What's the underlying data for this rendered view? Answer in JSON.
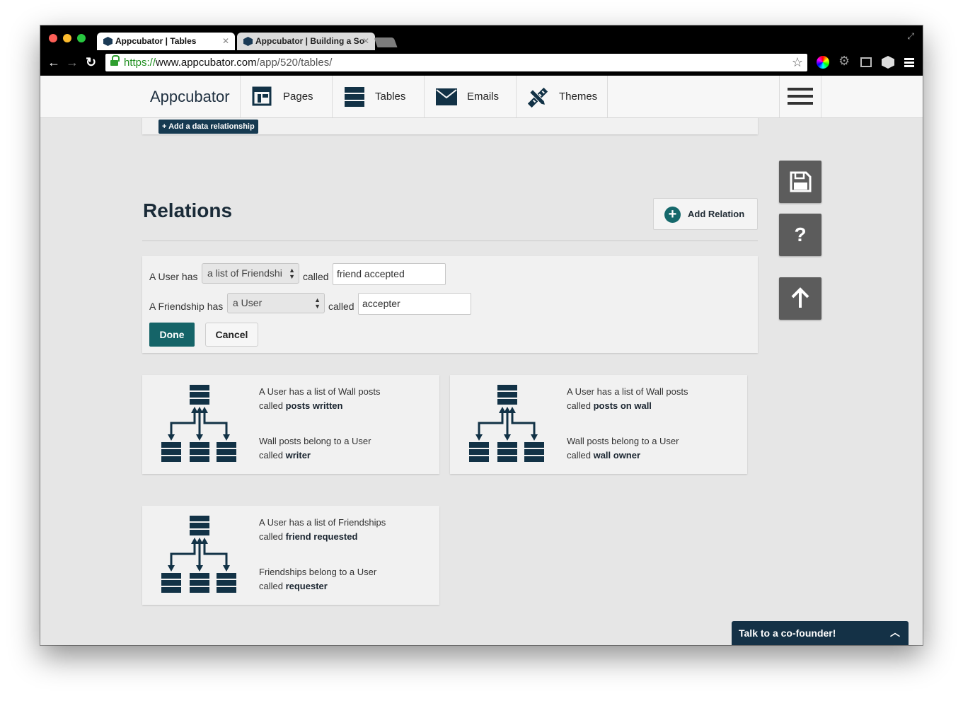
{
  "browser": {
    "tabs": [
      {
        "title": "Appcubator | Tables",
        "active": true
      },
      {
        "title": "Appcubator | Building a So",
        "active": false
      }
    ],
    "url_scheme": "https://",
    "url_host": "www.appcubator.com",
    "url_path": "/app/520/tables/"
  },
  "header": {
    "brand": "Appcubator",
    "nav": [
      {
        "label": "Pages",
        "icon": "pages-icon"
      },
      {
        "label": "Tables",
        "icon": "tables-icon"
      },
      {
        "label": "Emails",
        "icon": "emails-icon"
      },
      {
        "label": "Themes",
        "icon": "themes-icon"
      }
    ]
  },
  "upper_card": {
    "button_label": "+ Add a data relationship"
  },
  "relations": {
    "title": "Relations",
    "add_button": "Add Relation",
    "editor": {
      "row1_prefix": "A User has",
      "row1_select": "a list of Friendshi",
      "row1_called": "called",
      "row1_value": "friend accepted",
      "row2_prefix": "A Friendship has",
      "row2_select": "a User",
      "row2_called": "called",
      "row2_value": "accepter",
      "done": "Done",
      "cancel": "Cancel"
    },
    "cards": [
      {
        "line1": "A User has a list of Wall posts",
        "line2_prefix": "called ",
        "line2_bold": "posts written",
        "line3": "Wall posts belong to a User",
        "line4_prefix": "called ",
        "line4_bold": "writer"
      },
      {
        "line1": "A User has a list of Wall posts",
        "line2_prefix": "called ",
        "line2_bold": "posts on wall",
        "line3": "Wall posts belong to a User",
        "line4_prefix": "called ",
        "line4_bold": "wall owner"
      },
      {
        "line1": "A User has a list of Friendships",
        "line2_prefix": "called ",
        "line2_bold": "friend requested",
        "line3": "Friendships belong to a User",
        "line4_prefix": "called ",
        "line4_bold": "requester"
      }
    ]
  },
  "side_buttons": {
    "help": "?"
  },
  "chat": {
    "label": "Talk to a co-founder!"
  },
  "colors": {
    "primary": "#15686b",
    "dark_navy": "#163a51",
    "icon_navy": "#123246"
  }
}
